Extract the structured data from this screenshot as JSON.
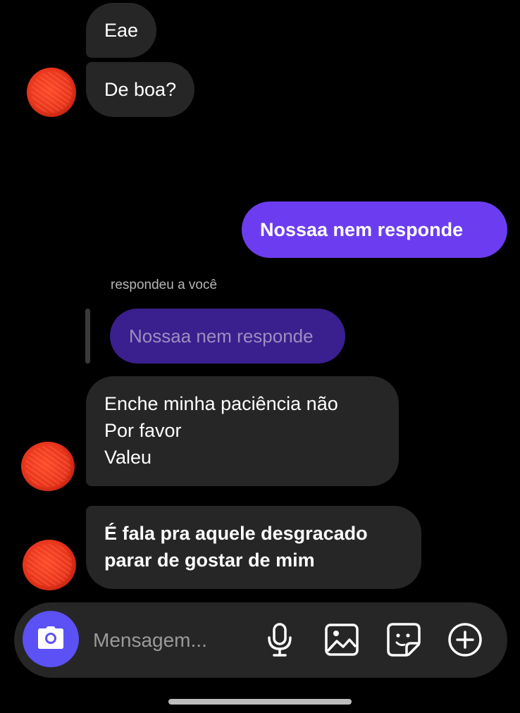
{
  "conversation": {
    "incoming_top": [
      {
        "text": "Eae"
      },
      {
        "text": "De boa?"
      }
    ],
    "outgoing": {
      "text": "Nossaa nem responde"
    },
    "reply": {
      "label": "respondeu a você",
      "quoted_text": "Nossaa nem responde"
    },
    "incoming_bottom": [
      {
        "lines": [
          "Enche minha paciência não",
          "Por favor",
          "Valeu"
        ]
      },
      {
        "lines": [
          "É fala pra aquele desgracado",
          "parar de gostar de mim"
        ]
      }
    ]
  },
  "composer": {
    "placeholder": "Mensagem...",
    "value": "",
    "icons": [
      "camera-icon",
      "microphone-icon",
      "image-icon",
      "sticker-icon",
      "plus-icon"
    ]
  },
  "colors": {
    "background": "#000000",
    "incoming_bubble": "#262626",
    "outgoing_bubble": "#6c3df0",
    "quoted_bubble": "#3a1f8e",
    "camera_button": "#5b51f5"
  }
}
